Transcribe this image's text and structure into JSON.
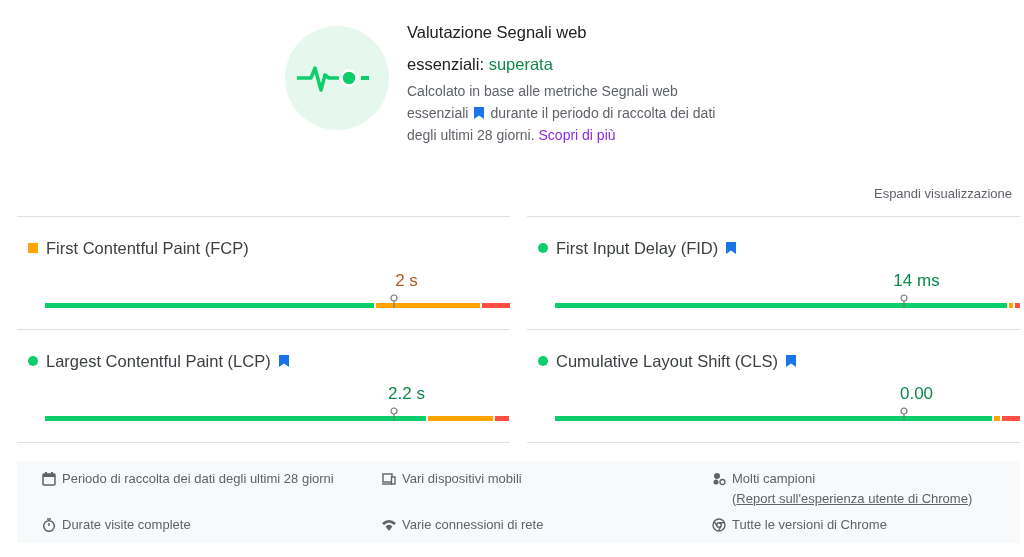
{
  "assessment": {
    "title": "Valutazione Segnali web essenziali:",
    "result": "superata",
    "description_before": "Calcolato in base alle metriche Segnali web essenziali",
    "description_after": "durante il periodo di raccolta dei dati degli ultimi 28 giorni.",
    "link": "Scopri di più"
  },
  "expand_link": "Espandi visualizzazione",
  "metrics": [
    {
      "name": "First Contentful Paint (FCP)",
      "indicator": {
        "kind": "square",
        "color": "#ffa400"
      },
      "value": "2 s",
      "level": 0.75
    },
    {
      "name": "First Input Delay (FID)",
      "indicator": {
        "kind": "dot",
        "color": "#0cce6b"
      },
      "info": true,
      "value": "14 ms",
      "level": 0.75
    },
    {
      "name": "Largest Contentful Paint (LCP)",
      "indicator": {
        "kind": "dot",
        "color": "#0cce6b"
      },
      "info": true,
      "value": "2.2 s",
      "level": 0.75
    },
    {
      "name": "Cumulative Layout Shift (CLS)",
      "indicator": {
        "kind": "dot",
        "color": "#0cce6b"
      },
      "info": true,
      "value": "0.00",
      "level": 0.75
    }
  ],
  "footer": [
    {
      "kind": "calendar",
      "text": "Periodo di raccolta dei dati degli ultimi 28 giorni"
    },
    {
      "kind": "devices",
      "text": "Vari dispositivi mobili"
    },
    {
      "kind": "samples",
      "text": "Molti campioni (",
      "link": "Report sull'esperienza utente di Chrome",
      "suffix": ")"
    },
    {
      "kind": "timer",
      "text": "Durate visite complete"
    },
    {
      "kind": "network",
      "text": "Varie connessioni di rete"
    },
    {
      "kind": "chrome",
      "text": "Tutte le versioni di Chrome"
    }
  ]
}
